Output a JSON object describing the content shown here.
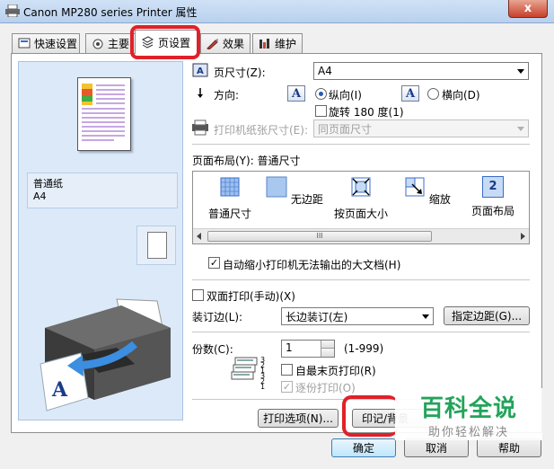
{
  "window": {
    "title": "Canon MP280 series Printer 属性",
    "close": "x"
  },
  "tabs": [
    {
      "label": "快速设置"
    },
    {
      "label": "主要"
    },
    {
      "label": "页设置"
    },
    {
      "label": "效果"
    },
    {
      "label": "维护"
    }
  ],
  "preview": {
    "media_name": "普通纸",
    "media_size": "A4"
  },
  "page_size": {
    "label": "页尺寸(Z):",
    "value": "A4"
  },
  "orientation": {
    "label": "方向:",
    "icon_letter": "A",
    "portrait": "纵向(I)",
    "landscape": "横向(D)",
    "rotate": "旋转 180 度(1)",
    "portrait_selected": true
  },
  "printer_paper": {
    "label": "打印机纸张尺寸(E):",
    "value": "同页面尺寸"
  },
  "page_layout": {
    "label": "页面布局(Y): 普通尺寸",
    "items": [
      {
        "label": "普通尺寸"
      },
      {
        "label": "无边距"
      },
      {
        "label": "按页面大小"
      },
      {
        "label": "缩放"
      },
      {
        "label": "页面布局"
      }
    ],
    "page_layout_badge": "2",
    "scroll_grip": "III"
  },
  "auto_reduce": {
    "label": "自动缩小打印机无法输出的大文档(H)",
    "checked": true
  },
  "duplex": {
    "label": "双面打印(手动)(X)",
    "checked": false
  },
  "stapling": {
    "label": "装订边(L):",
    "value": "长边装订(左)",
    "margin_button": "指定边距(G)..."
  },
  "copies": {
    "label": "份数(C):",
    "value": "1",
    "range": "(1-999)",
    "last_page_first": "自最末页打印(R)",
    "collate": "逐份打印(O)",
    "collate_checked": true,
    "stack_numbers": "321321"
  },
  "bottom_buttons": {
    "print_options": "打印选项(N)...",
    "stamp": "印记/背景",
    "ok": "确定",
    "cancel": "取消",
    "help": "帮助"
  },
  "watermark": {
    "title": "百科全说",
    "subtitle": "助你轻松解决"
  },
  "colors": {
    "accent_blue": "#2a5bb5",
    "highlight_red": "#e0202a",
    "watermark_green": "#23a35a"
  }
}
